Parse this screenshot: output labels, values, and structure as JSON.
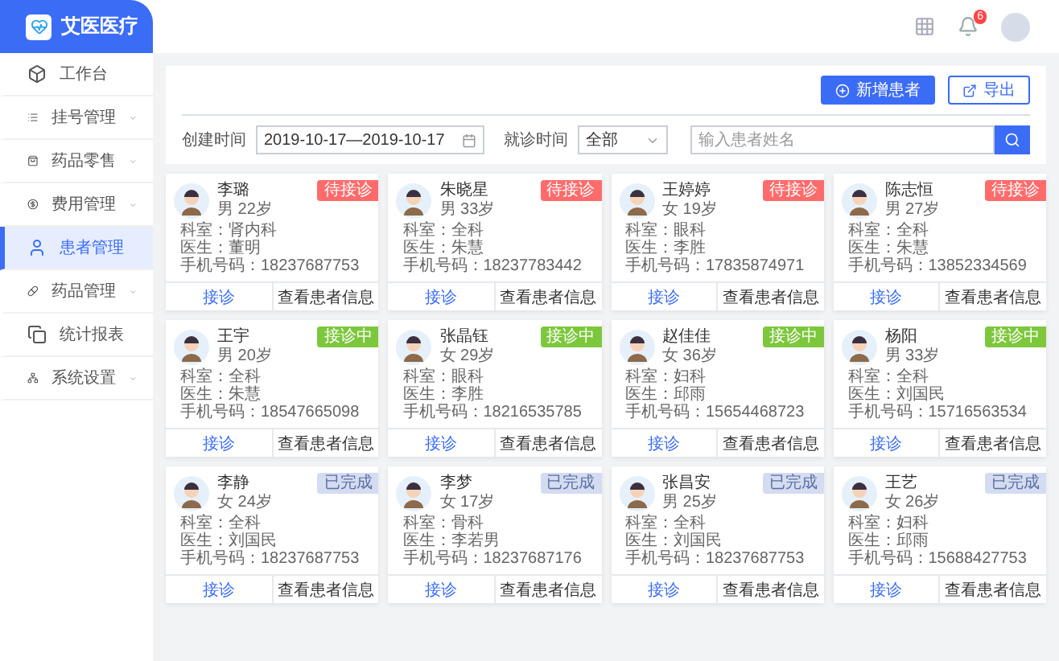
{
  "brand": {
    "name": "艾医医疗"
  },
  "header": {
    "notification_count": "6"
  },
  "sidebar": {
    "items": [
      {
        "label": "工作台",
        "expandable": false,
        "selected": false
      },
      {
        "label": "挂号管理",
        "expandable": true,
        "selected": false
      },
      {
        "label": "药品零售",
        "expandable": true,
        "selected": false
      },
      {
        "label": "费用管理",
        "expandable": true,
        "selected": false
      },
      {
        "label": "患者管理",
        "expandable": false,
        "selected": true
      },
      {
        "label": "药品管理",
        "expandable": true,
        "selected": false
      },
      {
        "label": "统计报表",
        "expandable": false,
        "selected": false
      },
      {
        "label": "系统设置",
        "expandable": true,
        "selected": false
      }
    ]
  },
  "toolbar": {
    "buttons": [
      {
        "label": "新增患者",
        "kind": "primary"
      },
      {
        "label": "导出",
        "kind": "outline"
      }
    ]
  },
  "filters": {
    "created_label": "创建时间",
    "created_value": "2019-10-17—2019-10-17",
    "visit_label": "就诊时间",
    "visit_value": "全部",
    "search": {
      "placeholder": "输入患者姓名"
    }
  },
  "patients": [
    {
      "name": "李璐",
      "sex_age": "男 22岁",
      "kind": "waiting",
      "status_label": "待接诊",
      "dept": "科室：肾内科",
      "doctor": "医生：董明",
      "phone": "手机号码：18237687753",
      "actions": [
        "接诊",
        "查看患者信息"
      ]
    },
    {
      "name": "朱晓星",
      "sex_age": "男 33岁",
      "kind": "waiting",
      "status_label": "待接诊",
      "dept": "科室：全科",
      "doctor": "医生：朱慧",
      "phone": "手机号码：18237783442",
      "actions": [
        "接诊",
        "查看患者信息"
      ]
    },
    {
      "name": "王婷婷",
      "sex_age": "女 19岁",
      "kind": "waiting",
      "status_label": "待接诊",
      "dept": "科室：眼科",
      "doctor": "医生：李胜",
      "phone": "手机号码：17835874971",
      "actions": [
        "接诊",
        "查看患者信息"
      ]
    },
    {
      "name": "陈志恒",
      "sex_age": "男 27岁",
      "kind": "waiting",
      "status_label": "待接诊",
      "dept": "科室：全科",
      "doctor": "医生：朱慧",
      "phone": "手机号码：13852334569",
      "actions": [
        "接诊",
        "查看患者信息"
      ]
    },
    {
      "name": "王宇",
      "sex_age": "男 20岁",
      "kind": "active",
      "status_label": "接诊中",
      "dept": "科室：全科",
      "doctor": "医生：朱慧",
      "phone": "手机号码：18547665098",
      "actions": [
        "接诊",
        "查看患者信息"
      ]
    },
    {
      "name": "张晶钰",
      "sex_age": "女 29岁",
      "kind": "active",
      "status_label": "接诊中",
      "dept": "科室：眼科",
      "doctor": "医生：李胜",
      "phone": "手机号码：18216535785",
      "actions": [
        "接诊",
        "查看患者信息"
      ]
    },
    {
      "name": "赵佳佳",
      "sex_age": "女 36岁",
      "kind": "active",
      "status_label": "接诊中",
      "dept": "科室：妇科",
      "doctor": "医生：邱雨",
      "phone": "手机号码：15654468723",
      "actions": [
        "接诊",
        "查看患者信息"
      ]
    },
    {
      "name": "杨阳",
      "sex_age": "男 33岁",
      "kind": "active",
      "status_label": "接诊中",
      "dept": "科室：全科",
      "doctor": "医生：刘国民",
      "phone": "手机号码：15716563534",
      "actions": [
        "接诊",
        "查看患者信息"
      ]
    },
    {
      "name": "李静",
      "sex_age": "女 24岁",
      "kind": "done",
      "status_label": "已完成",
      "dept": "科室：全科",
      "doctor": "医生：刘国民",
      "phone": "手机号码：18237687753",
      "actions": [
        "接诊",
        "查看患者信息"
      ]
    },
    {
      "name": "李梦",
      "sex_age": "女 17岁",
      "kind": "done",
      "status_label": "已完成",
      "dept": "科室：骨科",
      "doctor": "医生：李若男",
      "phone": "手机号码：18237687176",
      "actions": [
        "接诊",
        "查看患者信息"
      ]
    },
    {
      "name": "张昌安",
      "sex_age": "男 25岁",
      "kind": "done",
      "status_label": "已完成",
      "dept": "科室：全科",
      "doctor": "医生：刘国民",
      "phone": "手机号码：18237687753",
      "actions": [
        "接诊",
        "查看患者信息"
      ]
    },
    {
      "name": "王艺",
      "sex_age": "女 26岁",
      "kind": "done",
      "status_label": "已完成",
      "dept": "科室：妇科",
      "doctor": "医生：邱雨",
      "phone": "手机号码：15688427753",
      "actions": [
        "接诊",
        "查看患者信息"
      ]
    }
  ]
}
